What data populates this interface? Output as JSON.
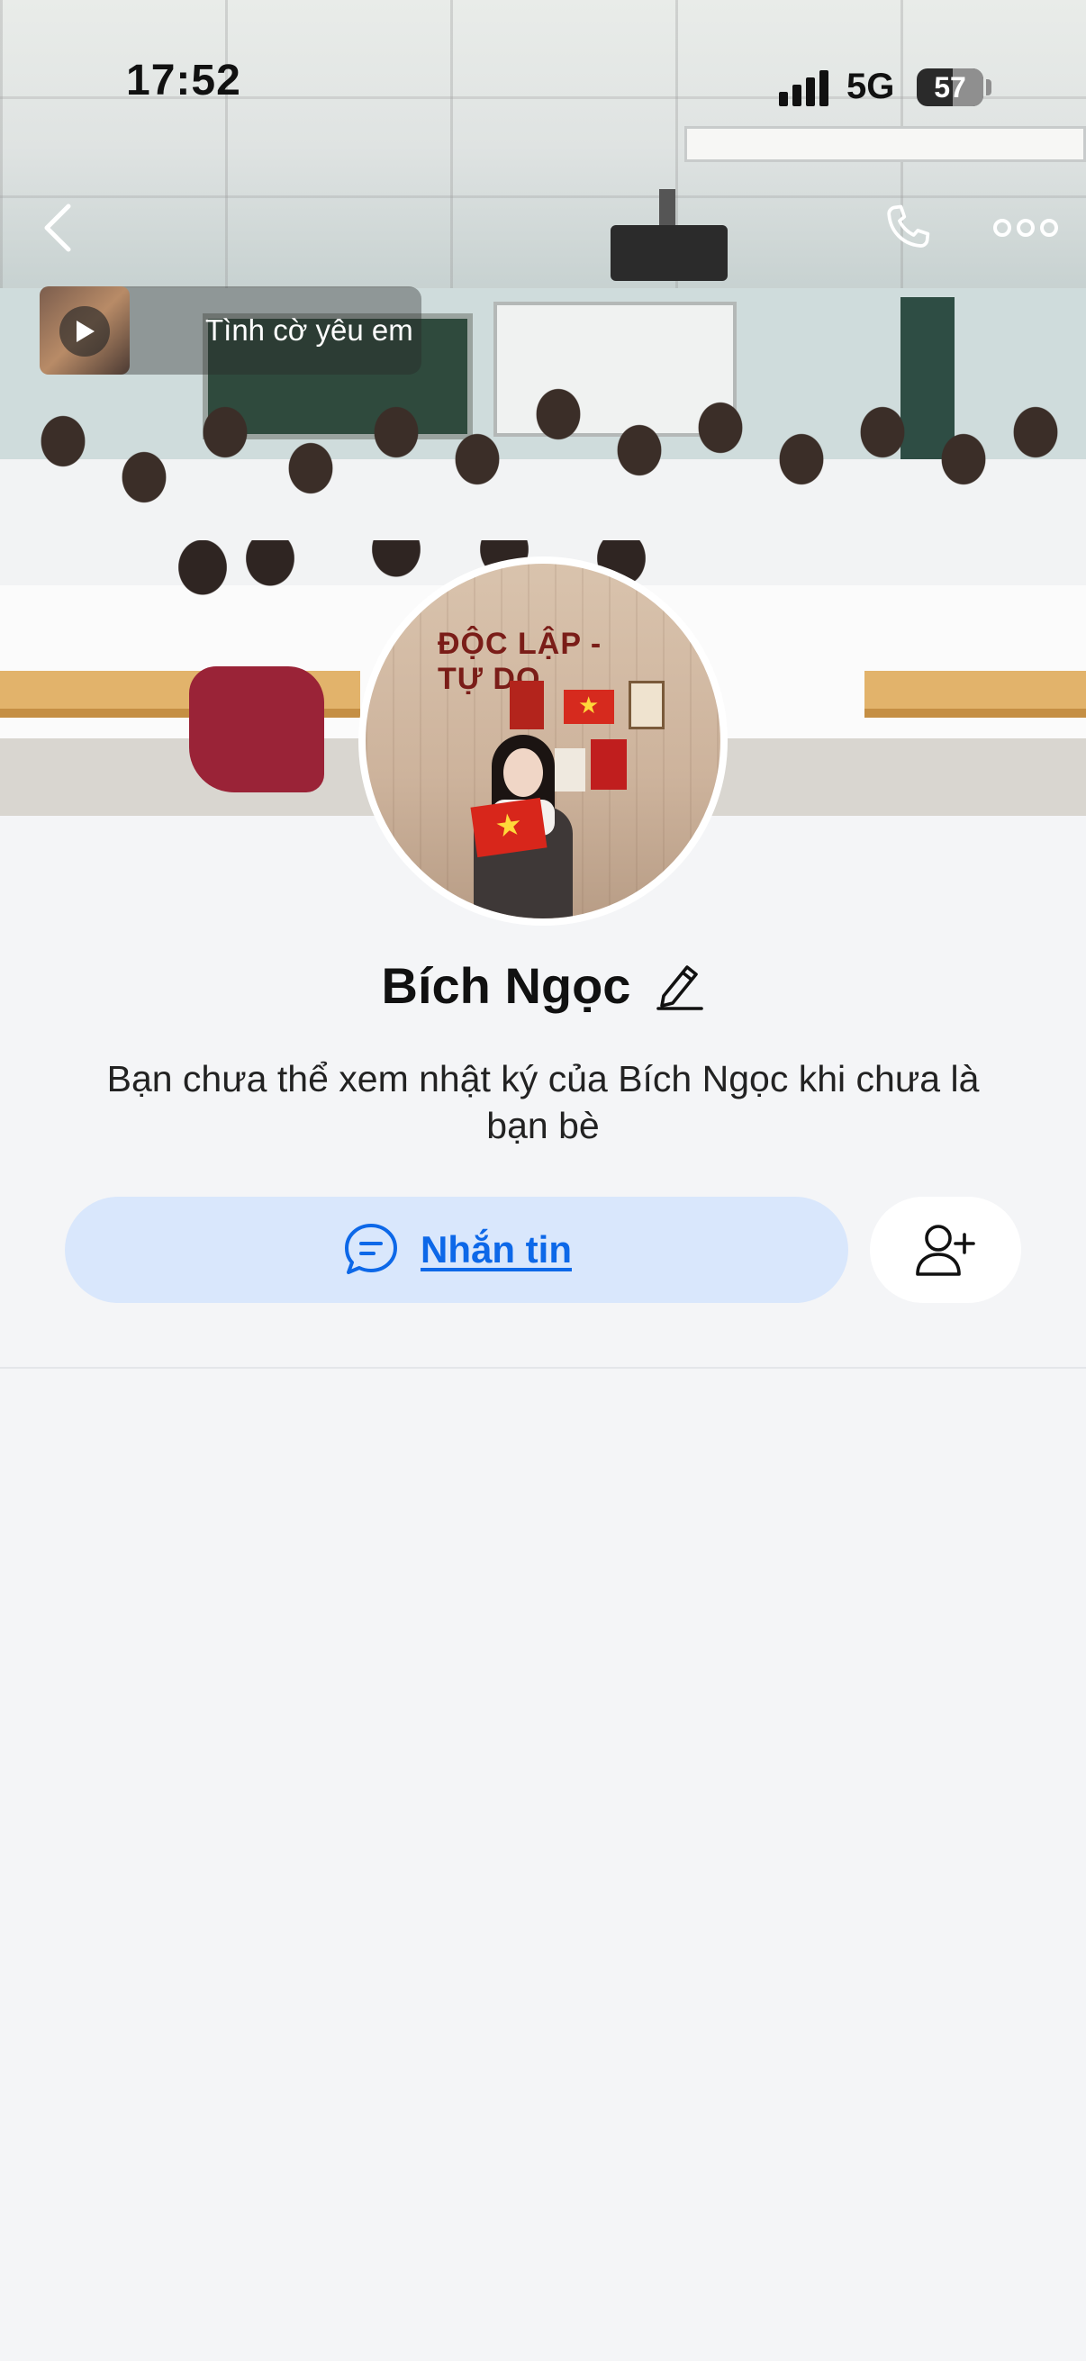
{
  "status_bar": {
    "time": "17:52",
    "network": "5G",
    "battery": "57",
    "icons": [
      "cellular-signal-icon",
      "battery-icon"
    ]
  },
  "header": {
    "icons": [
      "back-arrow-icon",
      "phone-icon",
      "more-dots-icon"
    ]
  },
  "music": {
    "title": "Tình cờ yêu em",
    "icon": "play-icon"
  },
  "cover": {
    "avatar_banner": "ĐỘC LẬP - TỰ DO"
  },
  "profile": {
    "name": "Bích Ngọc",
    "edit_icon": "pencil-icon",
    "notice": "Bạn chưa thể xem nhật ký của Bích Ngọc khi chưa là bạn bè"
  },
  "actions": {
    "message_label": "Nhắn tin",
    "message_icon": "chat-bubble-icon",
    "add_friend_icon": "add-friend-icon"
  },
  "colors": {
    "accent": "#0d68e8",
    "message_button_bg": "#d9e7fc",
    "page_bg": "#f4f5f7"
  }
}
